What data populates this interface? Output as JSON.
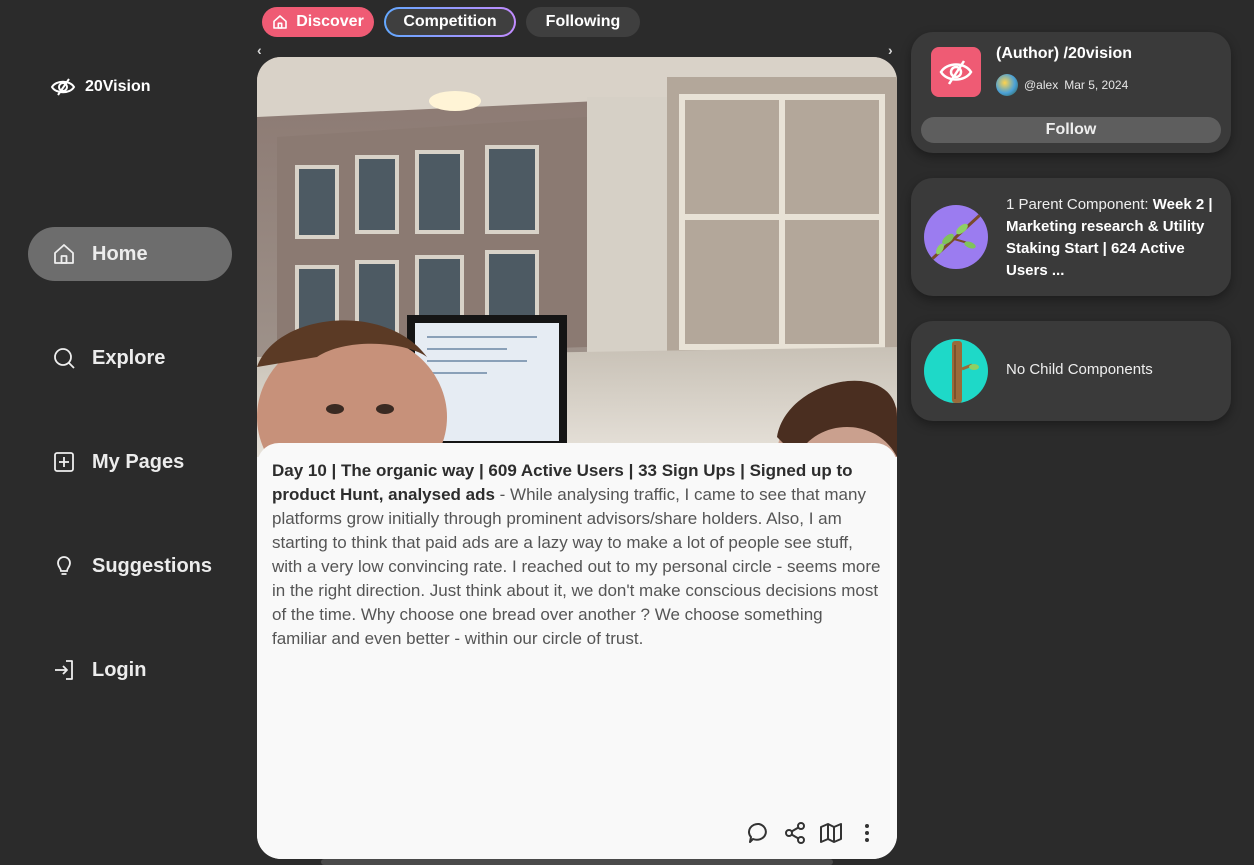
{
  "brand": {
    "name": "20Vision"
  },
  "nav": [
    {
      "label": "Home",
      "icon": "home-icon",
      "active": true
    },
    {
      "label": "Explore",
      "icon": "search-icon",
      "active": false
    },
    {
      "label": "My Pages",
      "icon": "plus-square-icon",
      "active": false
    },
    {
      "label": "Suggestions",
      "icon": "lightbulb-icon",
      "active": false
    },
    {
      "label": "Login",
      "icon": "login-icon",
      "active": false
    }
  ],
  "tabs": {
    "discover": "Discover",
    "competition": "Competition",
    "following": "Following"
  },
  "carousel": {
    "prev": "‹",
    "next": "›"
  },
  "post": {
    "title": "Day 10 | The organic way | 609 Active Users | 33 Sign Ups | Signed up to product Hunt, analysed ads",
    "separator": " -  ",
    "body": "While analysing traffic, I came to see that many platforms grow initially through prominent advisors/share holders. Also, I am starting to think that paid ads are a lazy way to make a lot of people see stuff, with a very low convincing rate. I reached out to my personal circle - seems more in the right direction. Just think about it, we don't make conscious decisions most of the time. Why choose one bread over another ? We choose something familiar and even better - within our circle of trust."
  },
  "author": {
    "title": "(Author) /20vision",
    "handle": "@alex",
    "date": "Mar 5, 2024",
    "follow_label": "Follow"
  },
  "parent": {
    "prefix": "1 Parent Component: ",
    "title": "Week 2 | Marketing research & Utility Staking Start | 624 Active Users ..."
  },
  "child": {
    "text": "No Child Components"
  },
  "colors": {
    "background": "#2b2b2b",
    "accent": "#ef5b74",
    "card": "#3a3a3a",
    "active_nav": "#6d6d6d"
  }
}
